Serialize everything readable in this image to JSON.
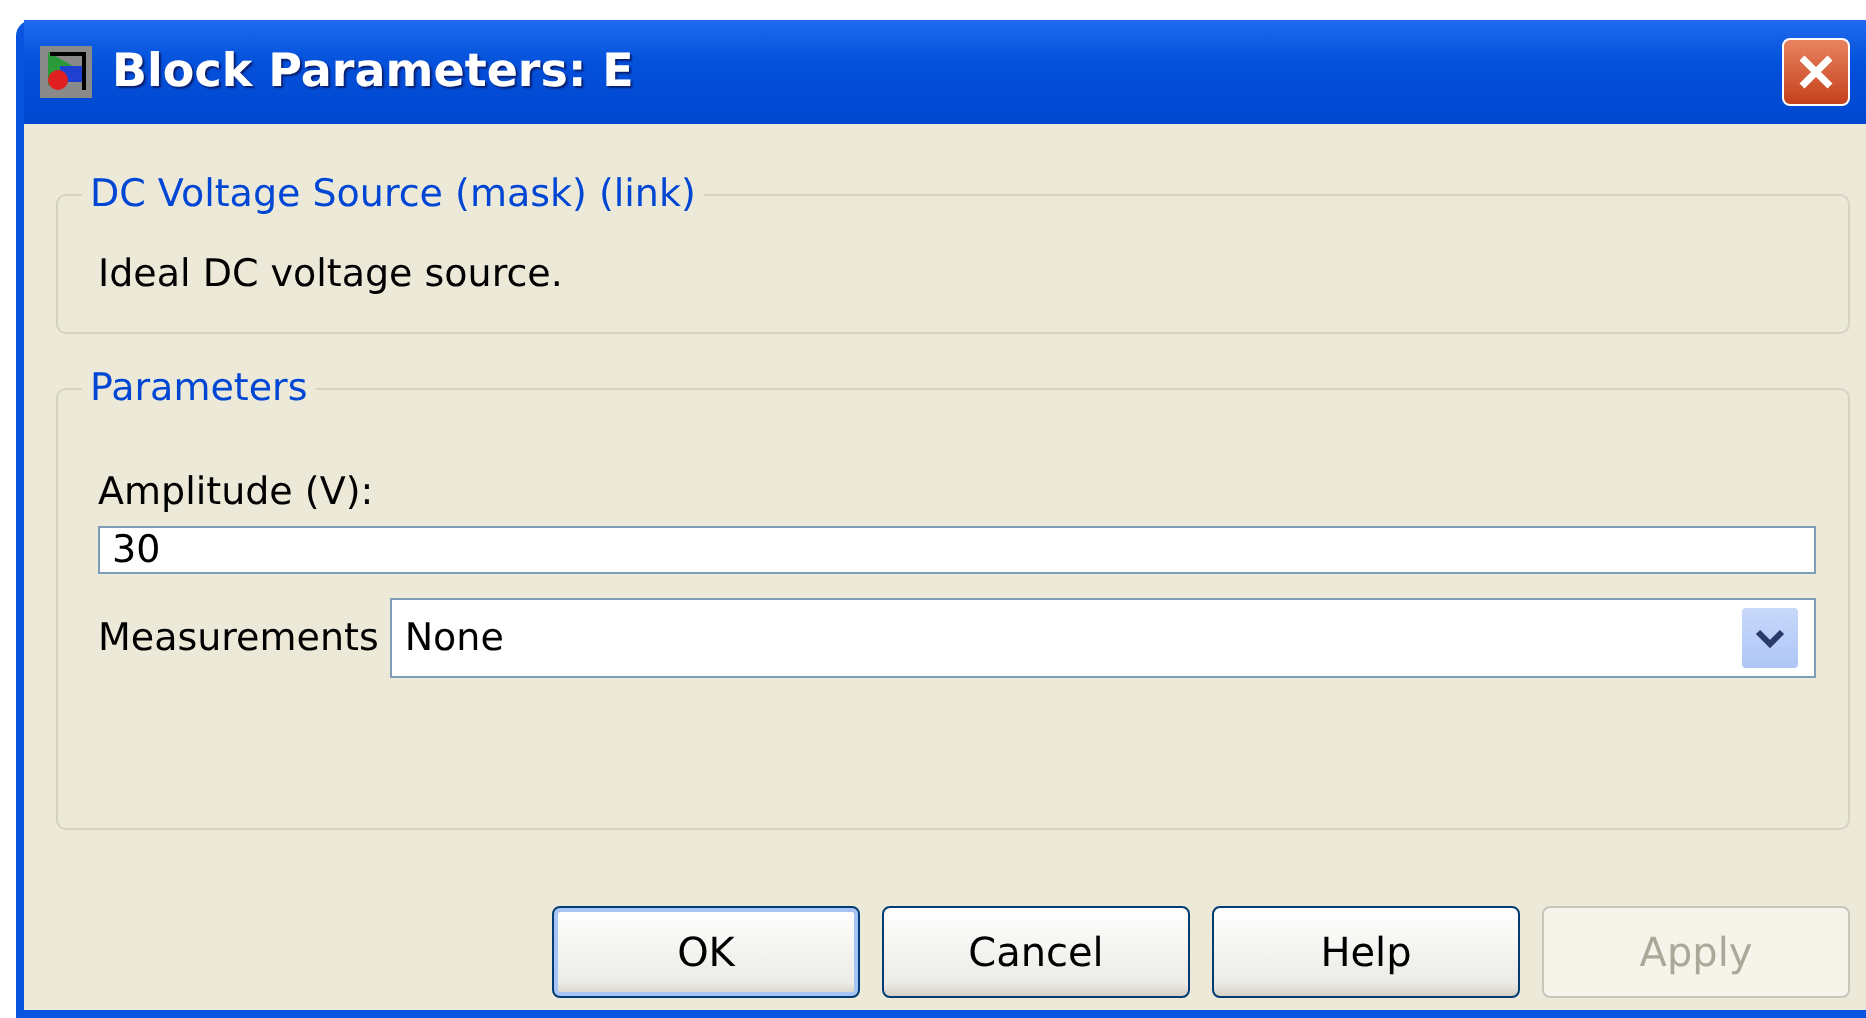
{
  "window": {
    "title": "Block Parameters: E"
  },
  "description_group": {
    "title": "DC Voltage Source (mask) (link)",
    "text": "Ideal DC voltage source."
  },
  "parameters_group": {
    "title": "Parameters",
    "fields": [
      {
        "kind": "text",
        "label": "Amplitude (V):",
        "value": "30"
      },
      {
        "kind": "dropdown",
        "label": "Measurements",
        "value": "None"
      }
    ]
  },
  "buttons": [
    {
      "label": "OK",
      "default": true,
      "disabled": false
    },
    {
      "label": "Cancel",
      "default": false,
      "disabled": false
    },
    {
      "label": "Help",
      "default": false,
      "disabled": false
    },
    {
      "label": "Apply",
      "default": false,
      "disabled": true
    }
  ]
}
